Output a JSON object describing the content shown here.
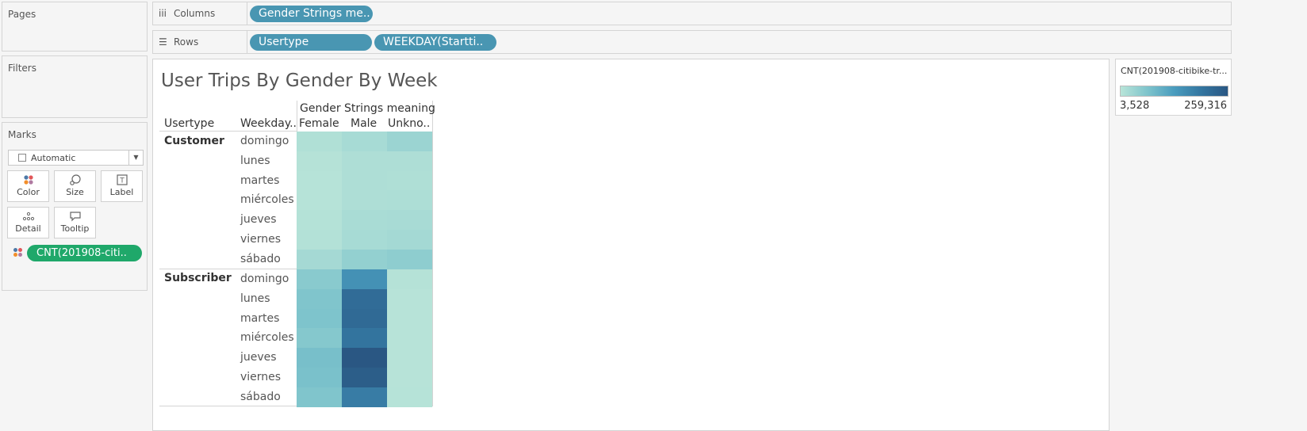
{
  "panels": {
    "pages_title": "Pages",
    "filters_title": "Filters",
    "marks_title": "Marks",
    "mark_type": "Automatic",
    "mark_buttons": [
      {
        "label": "Color",
        "icon": "color-icon"
      },
      {
        "label": "Size",
        "icon": "size-icon"
      },
      {
        "label": "Label",
        "icon": "label-icon"
      },
      {
        "label": "Detail",
        "icon": "detail-icon"
      },
      {
        "label": "Tooltip",
        "icon": "tooltip-icon"
      }
    ],
    "marks_pill": "CNT(201908-citi.."
  },
  "shelves": {
    "columns_label": "Columns",
    "rows_label": "Rows",
    "columns_pills": [
      "Gender Strings me.."
    ],
    "rows_pills": [
      "Usertype",
      "WEEKDAY(Startti.."
    ]
  },
  "viz": {
    "title": "User Trips By Gender By Week",
    "col_group_header": "Gender Strings meaning",
    "row_header_1": "Usertype",
    "row_header_2": "Weekday..",
    "columns": [
      "Female",
      "Male",
      "Unkno.."
    ]
  },
  "legend": {
    "title": "CNT(201908-citibike-tr...",
    "min_label": "3,528",
    "max_label": "259,316",
    "color_low": "#b8e4d8",
    "color_high": "#2a5783"
  },
  "chart_data": {
    "type": "heatmap",
    "title": "User Trips By Gender By Week",
    "x_header": "Gender Strings meaning",
    "columns": [
      "Female",
      "Male",
      "Unkno.."
    ],
    "row_groups": [
      {
        "usertype": "Customer",
        "days": [
          "domingo",
          "lunes",
          "martes",
          "miércoles",
          "jueves",
          "viernes",
          "sábado"
        ],
        "values": [
          [
            12000,
            22000,
            35000
          ],
          [
            7000,
            15000,
            15000
          ],
          [
            6000,
            15000,
            14000
          ],
          [
            6000,
            15000,
            16000
          ],
          [
            8000,
            20000,
            21000
          ],
          [
            9000,
            22000,
            26000
          ],
          [
            25000,
            44000,
            50000
          ]
        ]
      },
      {
        "usertype": "Subscriber",
        "days": [
          "domingo",
          "lunes",
          "martes",
          "miércoles",
          "jueves",
          "viernes",
          "sábado"
        ],
        "values": [
          [
            55000,
            150000,
            7000
          ],
          [
            65000,
            215000,
            5000
          ],
          [
            68000,
            220000,
            5000
          ],
          [
            60000,
            200000,
            5000
          ],
          [
            75000,
            259316,
            5000
          ],
          [
            72000,
            245000,
            5000
          ],
          [
            65000,
            185000,
            6000
          ]
        ]
      }
    ],
    "color_range": [
      3528,
      259316
    ]
  }
}
